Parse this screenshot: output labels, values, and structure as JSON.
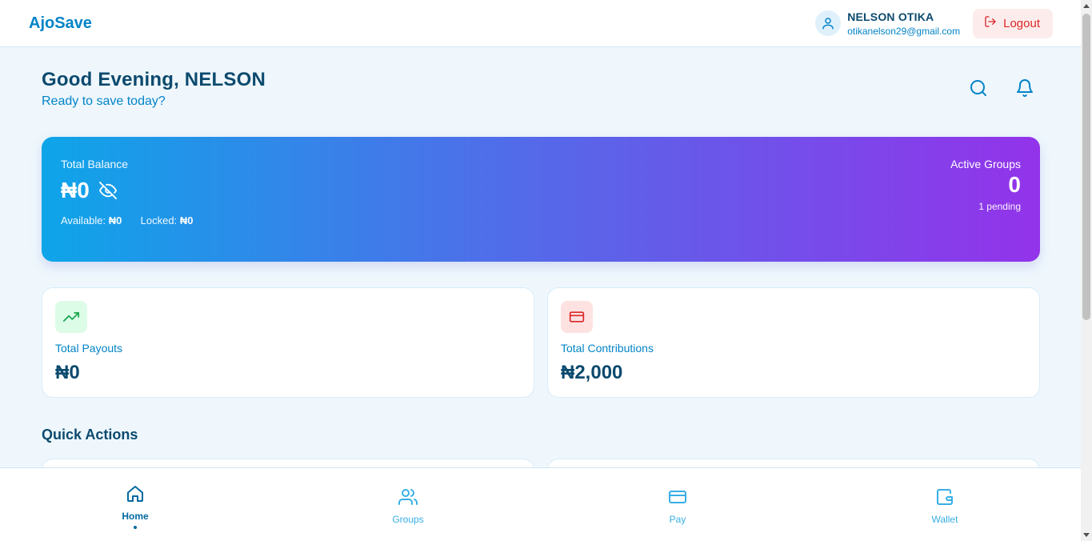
{
  "app": {
    "brand": "AjoSave"
  },
  "header": {
    "user_name": "NELSON OTIKA",
    "user_email": "otikanelson29@gmail.com",
    "logout_label": "Logout"
  },
  "greeting": {
    "title": "Good Evening, NELSON",
    "subtitle": "Ready to save today?"
  },
  "balance": {
    "label": "Total Balance",
    "amount": "₦0",
    "available_label": "Available:",
    "available_value": "₦0",
    "locked_label": "Locked:",
    "locked_value": "₦0"
  },
  "groups": {
    "label": "Active Groups",
    "count": "0",
    "pending": "1 pending"
  },
  "stats": [
    {
      "label": "Total Payouts",
      "value": "₦0",
      "icon": "trending-up-icon",
      "tint": "#dcfce7",
      "color": "#16a34a"
    },
    {
      "label": "Total Contributions",
      "value": "₦2,000",
      "icon": "credit-card-icon",
      "tint": "#fee2e2",
      "color": "#dc2626"
    }
  ],
  "quick_actions": {
    "title": "Quick Actions"
  },
  "nav": [
    {
      "label": "Home",
      "icon": "home-icon",
      "active": true
    },
    {
      "label": "Groups",
      "icon": "users-icon",
      "active": false
    },
    {
      "label": "Pay",
      "icon": "credit-card-icon",
      "active": false
    },
    {
      "label": "Wallet",
      "icon": "wallet-icon",
      "active": false
    }
  ],
  "colors": {
    "accent": "#0284c7",
    "text_dark": "#0c4a6e",
    "gradient_start": "#0ea5e9",
    "gradient_end": "#9333ea",
    "danger": "#dc2626"
  }
}
